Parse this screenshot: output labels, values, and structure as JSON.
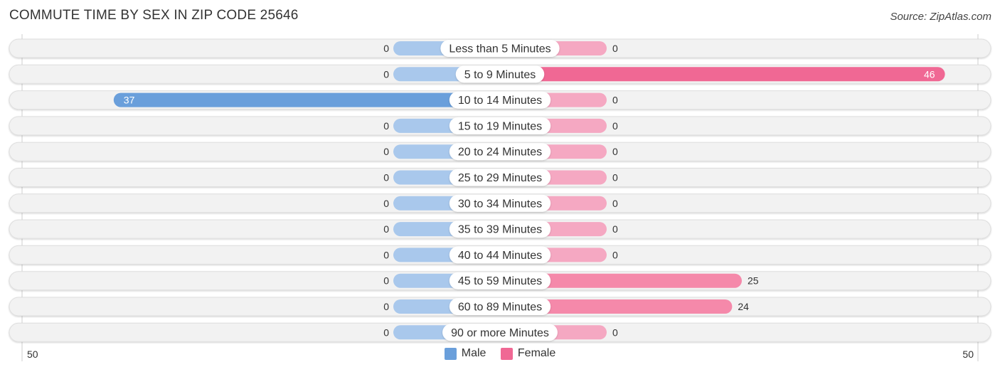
{
  "header": {
    "title": "COMMUTE TIME BY SEX IN ZIP CODE 25646",
    "source": "Source: ZipAtlas.com"
  },
  "colors": {
    "male": "#6a9fdb",
    "male_light": "#a9c8ec",
    "female": "#f06894",
    "female_light": "#f5a8c2",
    "track": "#f2f2f2"
  },
  "legend": {
    "male": "Male",
    "female": "Female"
  },
  "axis": {
    "left_label": "50",
    "right_label": "50"
  },
  "chart_data": {
    "type": "bar",
    "orientation": "horizontal-diverging",
    "title": "COMMUTE TIME BY SEX IN ZIP CODE 25646",
    "categories": [
      "Less than 5 Minutes",
      "5 to 9 Minutes",
      "10 to 14 Minutes",
      "15 to 19 Minutes",
      "20 to 24 Minutes",
      "25 to 29 Minutes",
      "30 to 34 Minutes",
      "35 to 39 Minutes",
      "40 to 44 Minutes",
      "45 to 59 Minutes",
      "60 to 89 Minutes",
      "90 or more Minutes"
    ],
    "series": [
      {
        "name": "Male",
        "values": [
          0,
          0,
          37,
          0,
          0,
          0,
          0,
          0,
          0,
          0,
          0,
          0
        ]
      },
      {
        "name": "Female",
        "values": [
          0,
          46,
          0,
          0,
          0,
          0,
          0,
          0,
          0,
          25,
          24,
          0
        ]
      }
    ],
    "xlim": [
      -50,
      50
    ],
    "legend_position": "bottom-center",
    "grid": false
  }
}
